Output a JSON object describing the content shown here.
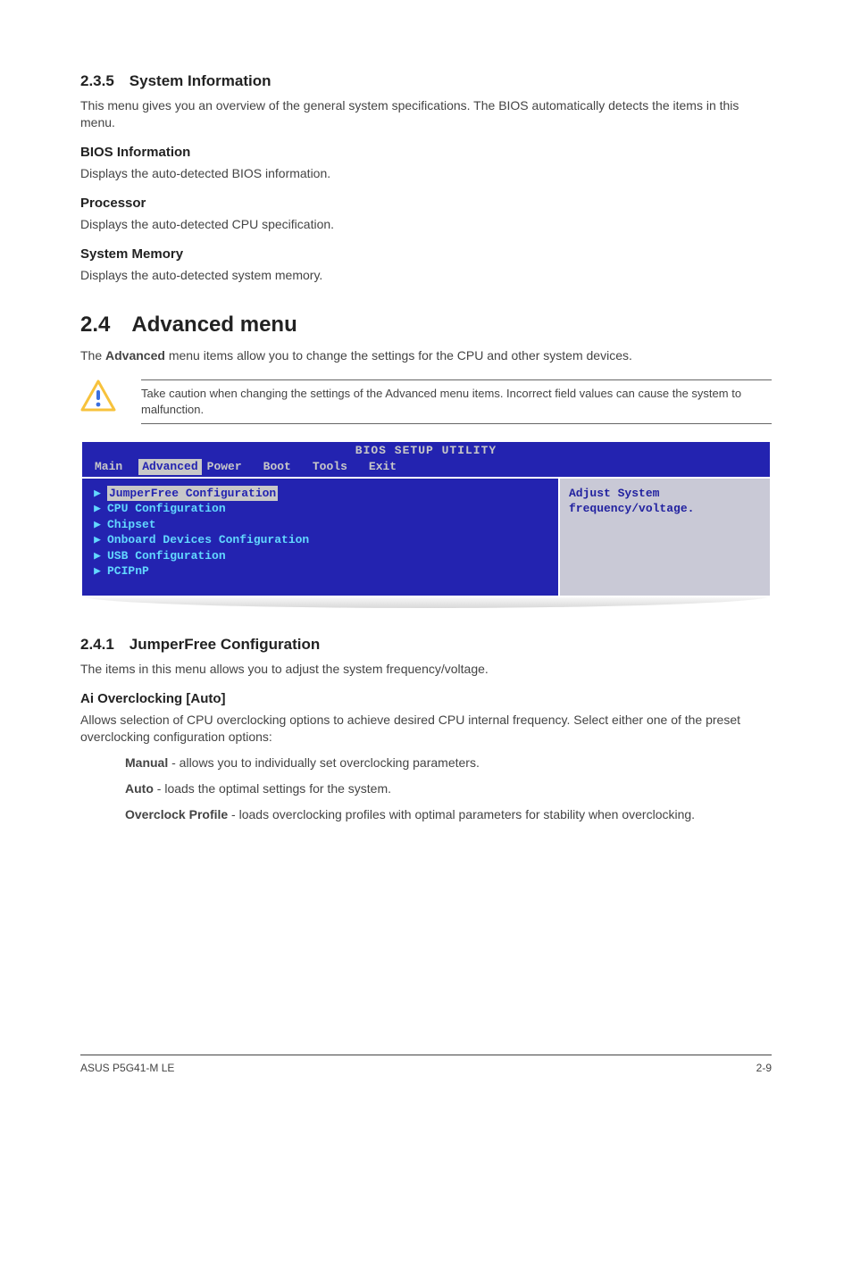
{
  "s235": {
    "heading": "2.3.5 System Information",
    "intro": "This menu gives you an overview of the general system specifications. The BIOS automatically detects the items in this menu.",
    "biosinfo_h": "BIOS Information",
    "biosinfo_p": "Displays the auto-detected BIOS information.",
    "proc_h": "Processor",
    "proc_p": "Displays the auto-detected CPU specification.",
    "mem_h": "System Memory",
    "mem_p": "Displays the auto-detected system memory."
  },
  "s24": {
    "heading": "2.4 Advanced menu",
    "intro_pre": "The ",
    "intro_bold": "Advanced",
    "intro_post": " menu items allow you to change the settings for the CPU and other system devices.",
    "caution": "Take caution when changing the settings of the Advanced menu items. Incorrect field values can cause the system to malfunction."
  },
  "bios": {
    "title": "BIOS SETUP UTILITY",
    "menu": [
      "Main",
      "Advanced",
      "Power",
      "Boot",
      "Tools",
      "Exit"
    ],
    "selected_menu_index": 1,
    "items": [
      "JumperFree Configuration",
      "CPU Configuration",
      "Chipset",
      "Onboard Devices Configuration",
      "USB Configuration",
      "PCIPnP"
    ],
    "selected_item_index": 0,
    "help_line1": "Adjust System",
    "help_line2": "frequency/voltage."
  },
  "s241": {
    "heading": "2.4.1 JumperFree Configuration",
    "intro": "The items in this menu allows you to adjust the system frequency/voltage.",
    "ai_h": "Ai Overclocking [Auto]",
    "ai_p": "Allows selection of CPU overclocking options to achieve desired CPU internal frequency. Select either one of the preset overclocking configuration options:",
    "opt1_b": "Manual",
    "opt1_t": " - allows you to individually set overclocking parameters.",
    "opt2_b": "Auto",
    "opt2_t": " - loads the optimal settings for the system.",
    "opt3_b": "Overclock Profile",
    "opt3_t": " - loads overclocking profiles with optimal parameters for stability when overclocking."
  },
  "footer": {
    "left": "ASUS P5G41-M LE",
    "right": "2-9"
  }
}
